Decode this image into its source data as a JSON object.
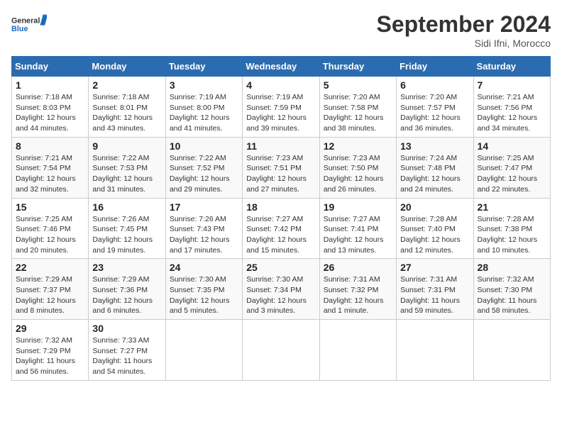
{
  "header": {
    "logo_general": "General",
    "logo_blue": "Blue",
    "month_title": "September 2024",
    "location": "Sidi Ifni, Morocco"
  },
  "weekdays": [
    "Sunday",
    "Monday",
    "Tuesday",
    "Wednesday",
    "Thursday",
    "Friday",
    "Saturday"
  ],
  "weeks": [
    [
      {
        "day": "1",
        "sunrise": "7:18 AM",
        "sunset": "8:03 PM",
        "daylight": "12 hours and 44 minutes."
      },
      {
        "day": "2",
        "sunrise": "7:18 AM",
        "sunset": "8:01 PM",
        "daylight": "12 hours and 43 minutes."
      },
      {
        "day": "3",
        "sunrise": "7:19 AM",
        "sunset": "8:00 PM",
        "daylight": "12 hours and 41 minutes."
      },
      {
        "day": "4",
        "sunrise": "7:19 AM",
        "sunset": "7:59 PM",
        "daylight": "12 hours and 39 minutes."
      },
      {
        "day": "5",
        "sunrise": "7:20 AM",
        "sunset": "7:58 PM",
        "daylight": "12 hours and 38 minutes."
      },
      {
        "day": "6",
        "sunrise": "7:20 AM",
        "sunset": "7:57 PM",
        "daylight": "12 hours and 36 minutes."
      },
      {
        "day": "7",
        "sunrise": "7:21 AM",
        "sunset": "7:56 PM",
        "daylight": "12 hours and 34 minutes."
      }
    ],
    [
      {
        "day": "8",
        "sunrise": "7:21 AM",
        "sunset": "7:54 PM",
        "daylight": "12 hours and 32 minutes."
      },
      {
        "day": "9",
        "sunrise": "7:22 AM",
        "sunset": "7:53 PM",
        "daylight": "12 hours and 31 minutes."
      },
      {
        "day": "10",
        "sunrise": "7:22 AM",
        "sunset": "7:52 PM",
        "daylight": "12 hours and 29 minutes."
      },
      {
        "day": "11",
        "sunrise": "7:23 AM",
        "sunset": "7:51 PM",
        "daylight": "12 hours and 27 minutes."
      },
      {
        "day": "12",
        "sunrise": "7:23 AM",
        "sunset": "7:50 PM",
        "daylight": "12 hours and 26 minutes."
      },
      {
        "day": "13",
        "sunrise": "7:24 AM",
        "sunset": "7:48 PM",
        "daylight": "12 hours and 24 minutes."
      },
      {
        "day": "14",
        "sunrise": "7:25 AM",
        "sunset": "7:47 PM",
        "daylight": "12 hours and 22 minutes."
      }
    ],
    [
      {
        "day": "15",
        "sunrise": "7:25 AM",
        "sunset": "7:46 PM",
        "daylight": "12 hours and 20 minutes."
      },
      {
        "day": "16",
        "sunrise": "7:26 AM",
        "sunset": "7:45 PM",
        "daylight": "12 hours and 19 minutes."
      },
      {
        "day": "17",
        "sunrise": "7:26 AM",
        "sunset": "7:43 PM",
        "daylight": "12 hours and 17 minutes."
      },
      {
        "day": "18",
        "sunrise": "7:27 AM",
        "sunset": "7:42 PM",
        "daylight": "12 hours and 15 minutes."
      },
      {
        "day": "19",
        "sunrise": "7:27 AM",
        "sunset": "7:41 PM",
        "daylight": "12 hours and 13 minutes."
      },
      {
        "day": "20",
        "sunrise": "7:28 AM",
        "sunset": "7:40 PM",
        "daylight": "12 hours and 12 minutes."
      },
      {
        "day": "21",
        "sunrise": "7:28 AM",
        "sunset": "7:38 PM",
        "daylight": "12 hours and 10 minutes."
      }
    ],
    [
      {
        "day": "22",
        "sunrise": "7:29 AM",
        "sunset": "7:37 PM",
        "daylight": "12 hours and 8 minutes."
      },
      {
        "day": "23",
        "sunrise": "7:29 AM",
        "sunset": "7:36 PM",
        "daylight": "12 hours and 6 minutes."
      },
      {
        "day": "24",
        "sunrise": "7:30 AM",
        "sunset": "7:35 PM",
        "daylight": "12 hours and 5 minutes."
      },
      {
        "day": "25",
        "sunrise": "7:30 AM",
        "sunset": "7:34 PM",
        "daylight": "12 hours and 3 minutes."
      },
      {
        "day": "26",
        "sunrise": "7:31 AM",
        "sunset": "7:32 PM",
        "daylight": "12 hours and 1 minute."
      },
      {
        "day": "27",
        "sunrise": "7:31 AM",
        "sunset": "7:31 PM",
        "daylight": "11 hours and 59 minutes."
      },
      {
        "day": "28",
        "sunrise": "7:32 AM",
        "sunset": "7:30 PM",
        "daylight": "11 hours and 58 minutes."
      }
    ],
    [
      {
        "day": "29",
        "sunrise": "7:32 AM",
        "sunset": "7:29 PM",
        "daylight": "11 hours and 56 minutes."
      },
      {
        "day": "30",
        "sunrise": "7:33 AM",
        "sunset": "7:27 PM",
        "daylight": "11 hours and 54 minutes."
      },
      null,
      null,
      null,
      null,
      null
    ]
  ]
}
